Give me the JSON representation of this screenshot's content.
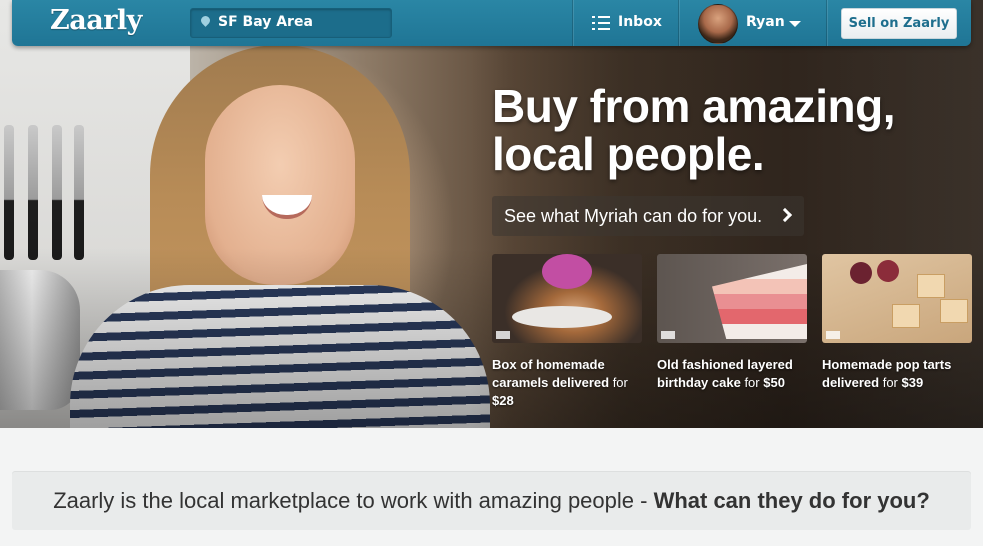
{
  "header": {
    "logo": "Zaarly",
    "location": "SF Bay Area",
    "inbox_label": "Inbox",
    "user_name": "Ryan",
    "sell_button": "Sell on Zaarly"
  },
  "hero": {
    "headline_line1": "Buy from amazing,",
    "headline_line2": "local people.",
    "cta": "See what Myriah can do for you."
  },
  "cards": [
    {
      "bold": "Box of homemade caramels delivered",
      "rest": " for ",
      "price": "$28"
    },
    {
      "bold": "Old fashioned layered birthday cake",
      "rest": " for ",
      "price": "$50"
    },
    {
      "bold": "Homemade pop tarts delivered",
      "rest": " for ",
      "price": "$39"
    }
  ],
  "tagline": {
    "text": "Zaarly is the local marketplace to work with amazing people - ",
    "bold": "What can they do for you?"
  },
  "colors": {
    "header_bg": "#2a86a5",
    "sell_button_text": "#1d6e8d"
  }
}
